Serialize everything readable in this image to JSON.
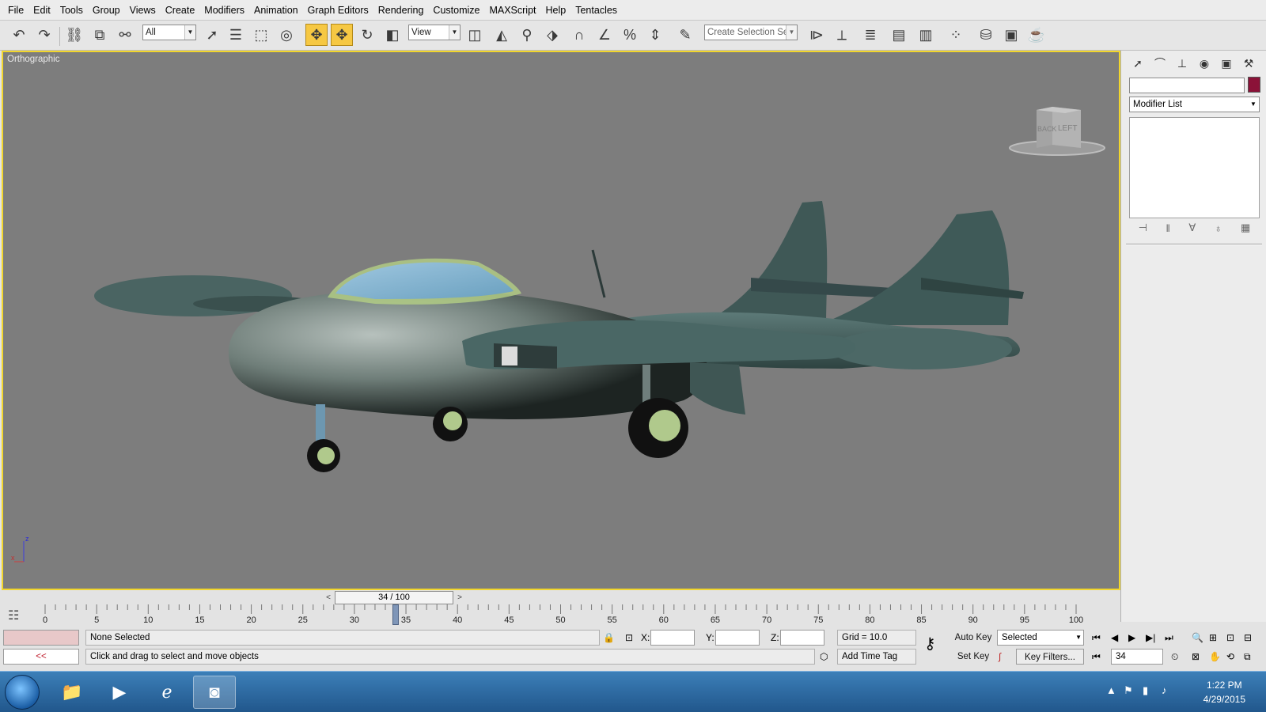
{
  "menu": [
    "File",
    "Edit",
    "Tools",
    "Group",
    "Views",
    "Create",
    "Modifiers",
    "Animation",
    "Graph Editors",
    "Rendering",
    "Customize",
    "MAXScript",
    "Help",
    "Tentacles"
  ],
  "toolbar": {
    "selection_filter": "All",
    "ref_coord": "View",
    "selection_set_placeholder": "Create Selection Set"
  },
  "viewport": {
    "label": "Orthographic",
    "viewcube_faces": [
      "BACK",
      "LEFT"
    ],
    "axis_labels": {
      "z": "z",
      "x": "x"
    }
  },
  "command_panel": {
    "name_value": "",
    "object_color": "#8b1238",
    "modifier_list": "Modifier List"
  },
  "time_slider": {
    "text": "34 / 100",
    "current": 34,
    "total": 100
  },
  "timeline": {
    "labels": [
      "0",
      "5",
      "10",
      "15",
      "20",
      "25",
      "30",
      "35",
      "40",
      "45",
      "50",
      "55",
      "60",
      "65",
      "70",
      "75",
      "80",
      "85",
      "90",
      "95",
      "100"
    ]
  },
  "status": {
    "selection": "None Selected",
    "prompt": "Click and drag to select and move objects",
    "back_button": "<<",
    "x_label": "X:",
    "y_label": "Y:",
    "z_label": "Z:",
    "grid": "Grid = 10.0",
    "add_time_tag": "Add Time Tag",
    "auto_key": "Auto Key",
    "set_key": "Set Key",
    "key_mode": "Selected",
    "key_filters": "Key Filters...",
    "frame": "34"
  },
  "taskbar": {
    "time": "1:22 PM",
    "date": "4/29/2015"
  }
}
